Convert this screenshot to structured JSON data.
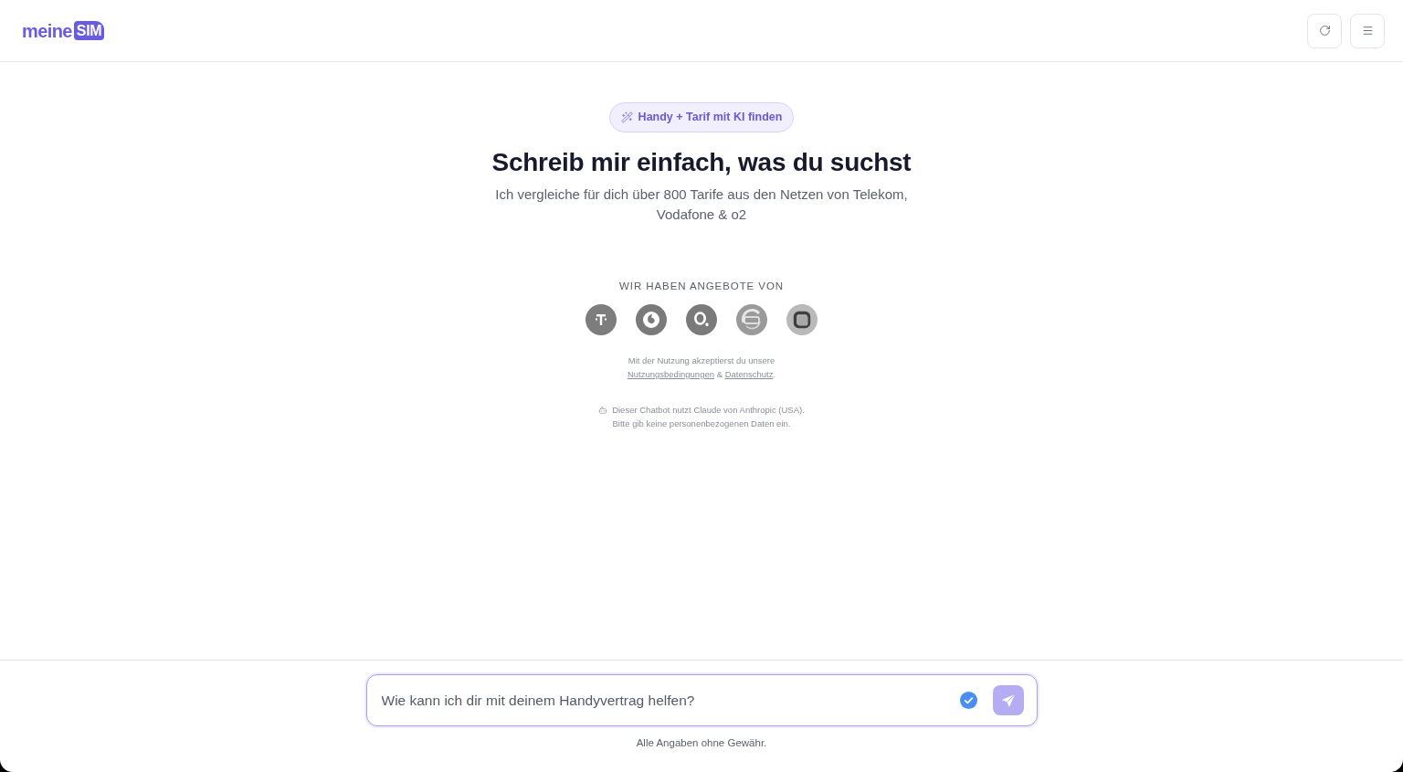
{
  "header": {
    "logo": {
      "word": "meine",
      "tag": "SIM"
    }
  },
  "hero": {
    "badge": "Handy + Tarif mit KI finden",
    "heading": "Schreib mir einfach, was du suchst",
    "subtitle": "Ich vergleiche für dich über 800 Tarife aus den Netzen von Telekom, Vodafone & o2"
  },
  "providers": {
    "title": "WIR HABEN ANGEBOTE VON"
  },
  "consent": {
    "text": "Mit der Nutzung akzeptierst du unsere",
    "links": [
      "Nutzungsbedingungen",
      "Datenschutz"
    ],
    "separator": "&",
    "end": "."
  },
  "notice": {
    "lines": [
      "Dieser Chatbot nutzt Claude von Anthropic (USA).",
      "Bitte gib keine personenbezogenen Daten ein."
    ]
  },
  "composer": {
    "placeholder": "Wie kann ich dir mit deinem Handyvertrag helfen?",
    "focused": true,
    "send_disabled": true
  },
  "disclaimer": "Alle Angaben ohne Gewähr."
}
